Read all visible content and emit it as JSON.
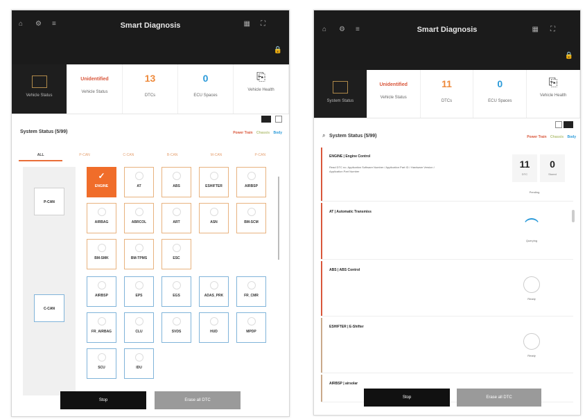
{
  "left": {
    "title": "Smart Diagnosis",
    "status": {
      "vehicle_label": "Vehicle Status",
      "unidentified": "Unidentified",
      "dtc_count": "13",
      "dtc_label": "DTCs",
      "ecu_count": "0",
      "ecu_label": "ECU Spaces",
      "icon_label": "Vehicle Health"
    },
    "system_status": "System Status (5/99)",
    "legend": {
      "power": "Power Train",
      "chassis": "Chassis",
      "body": "Body"
    },
    "tabs": [
      "ALL",
      "P-CAN",
      "C-CAN",
      "B-CAN",
      "M-CAN",
      "P-CAN"
    ],
    "gate1": "P-CAN",
    "gate2": "C-CAN",
    "tiles_orange": [
      "ENGINE",
      "AT",
      "ABS",
      "ESHIFTER",
      "AIRBSP",
      "AIRBAG",
      "ABRCOL",
      "ART",
      "ASN",
      "BM-SCM",
      "BM-SMK",
      "BM-TPMS",
      "ESC"
    ],
    "tiles_blue": [
      "AIRBSP",
      "EPS",
      "EGS",
      "ADAS_PRK",
      "FR_CMR",
      "FR_AIRBAG",
      "CLU",
      "SVDS",
      "HUD",
      "MPDP",
      "SCU",
      "IDU"
    ],
    "stop": "Stop",
    "erase": "Erase all DTC"
  },
  "right": {
    "title": "Smart Diagnosis",
    "status": {
      "vehicle_label": "System Status",
      "unidentified": "Unidentified",
      "sub_label": "Vehicle Status",
      "dtc_count": "11",
      "dtc_label": "DTCs",
      "ecu_count": "0",
      "ecu_label": "ECU Spaces",
      "icon_label": "Vehicle Health"
    },
    "system_status": "System Status (5/99)",
    "legend": {
      "power": "Power Train",
      "chassis": "Chassis",
      "body": "Body"
    },
    "rows": [
      {
        "name": "ENGINE | Engine Control",
        "desc": "Read DTC no. Application Software Number / Application Part ID / Hardware Version / Application Part Number",
        "dtc": "11",
        "dtc_label": "DTC",
        "other": "0",
        "other_label": "Stored",
        "status": "Pending",
        "color": "#d9563a"
      },
      {
        "name": "AT | Automatic Transmiss",
        "status": "Querying",
        "color": "#d9563a"
      },
      {
        "name": "ABS | ABS Control",
        "status": "Ready",
        "color": "#d9563a"
      },
      {
        "name": "ESHIFTER | E-Shifter",
        "status": "Ready",
        "color": "#c9a98a"
      },
      {
        "name": "AIRBSP | airsolar",
        "status": "",
        "color": "#c9a98a"
      }
    ],
    "stop": "Stop",
    "erase": "Erase all DTC"
  },
  "colors": {
    "accent": "#f06d2a",
    "dark": "#1b1b1b",
    "red": "#d9563a",
    "blue": "#2a9ad9"
  }
}
